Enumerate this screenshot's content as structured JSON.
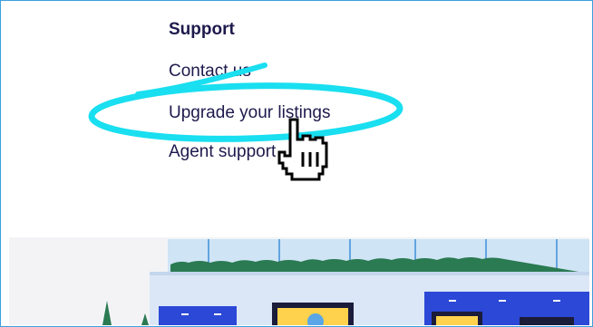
{
  "support_menu": {
    "heading": "Support",
    "links": [
      {
        "label": "Contact us"
      },
      {
        "label": "Upgrade your listings"
      },
      {
        "label": "Agent support"
      }
    ]
  },
  "annotation": {
    "highlight_color": "#19dff0",
    "highlighted_item": "Upgrade your listings"
  },
  "icons": {
    "cursor": "hand-pointer-icon"
  },
  "colors": {
    "text": "#1e1a4d",
    "frame_border": "#3aa0e0",
    "hedge": "#2a7a52",
    "building_blue": "#2b48d6",
    "window_yellow": "#ffd24d",
    "sky": "#cfe4f5"
  }
}
